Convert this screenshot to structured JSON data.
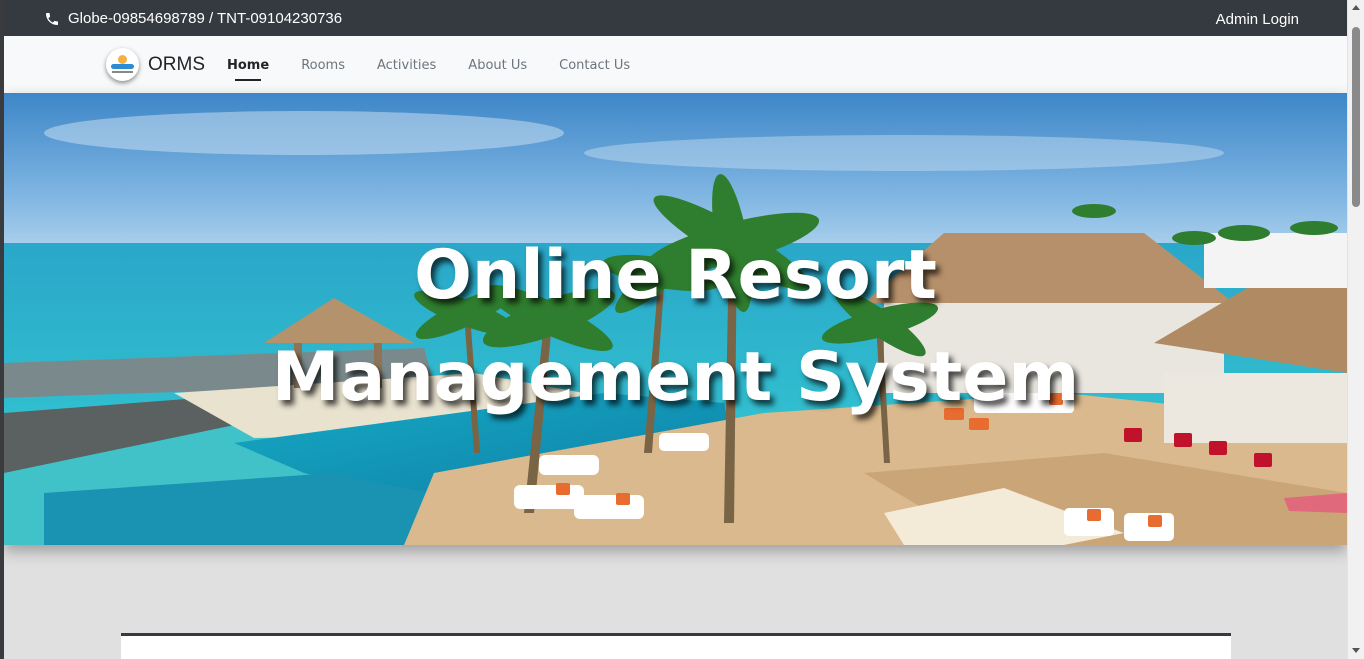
{
  "topbar": {
    "contact": "Globe-09854698789 / TNT-09104230736",
    "admin_login": "Admin Login"
  },
  "navbar": {
    "brand": "ORMS",
    "links": [
      "Home",
      "Rooms",
      "Activities",
      "About Us",
      "Contact Us"
    ],
    "active": "Home"
  },
  "hero": {
    "title": "Online Resort Management System"
  },
  "icons": {
    "phone": "phone-icon",
    "logo": "resort-logo"
  },
  "colors": {
    "topbar_bg": "#343a40",
    "navbar_bg": "#f8f9fa",
    "page_bg": "#e0e0e0"
  }
}
